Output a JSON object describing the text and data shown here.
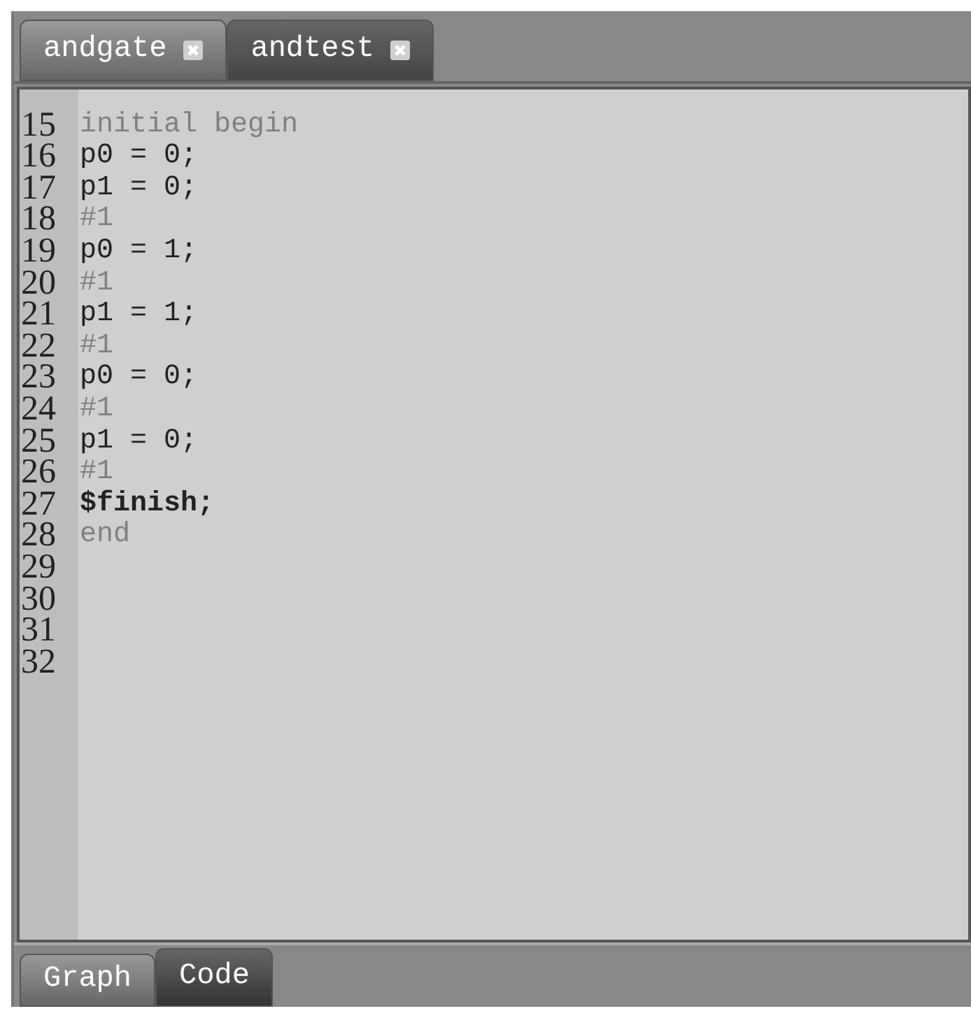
{
  "file_tabs": [
    {
      "label": "andgate",
      "selected": false
    },
    {
      "label": "andtest",
      "selected": true
    }
  ],
  "lines": [
    {
      "number": "15",
      "text": "initial begin",
      "kind": "keyword"
    },
    {
      "number": "16",
      "text": "p0 = 0;",
      "kind": "plain"
    },
    {
      "number": "17",
      "text": "p1 = 0;",
      "kind": "plain"
    },
    {
      "number": "18",
      "text": "#1",
      "kind": "delay"
    },
    {
      "number": "19",
      "text": "p0 = 1;",
      "kind": "plain"
    },
    {
      "number": "20",
      "text": "#1",
      "kind": "delay"
    },
    {
      "number": "21",
      "text": "p1 = 1;",
      "kind": "plain"
    },
    {
      "number": "22",
      "text": "#1",
      "kind": "delay"
    },
    {
      "number": "23",
      "text": "p0 = 0;",
      "kind": "plain"
    },
    {
      "number": "24",
      "text": "#1",
      "kind": "delay"
    },
    {
      "number": "25",
      "text": "p1 = 0;",
      "kind": "plain"
    },
    {
      "number": "26",
      "text": "#1",
      "kind": "delay"
    },
    {
      "number": "27",
      "text": "$finish;",
      "kind": "system"
    },
    {
      "number": "28",
      "text": "end",
      "kind": "keyword"
    },
    {
      "number": "29"
    },
    {
      "number": "30"
    },
    {
      "number": "31"
    },
    {
      "number": "32"
    }
  ],
  "view_tabs": [
    {
      "label": "Graph",
      "selected": false
    },
    {
      "label": "Code",
      "selected": true
    }
  ]
}
